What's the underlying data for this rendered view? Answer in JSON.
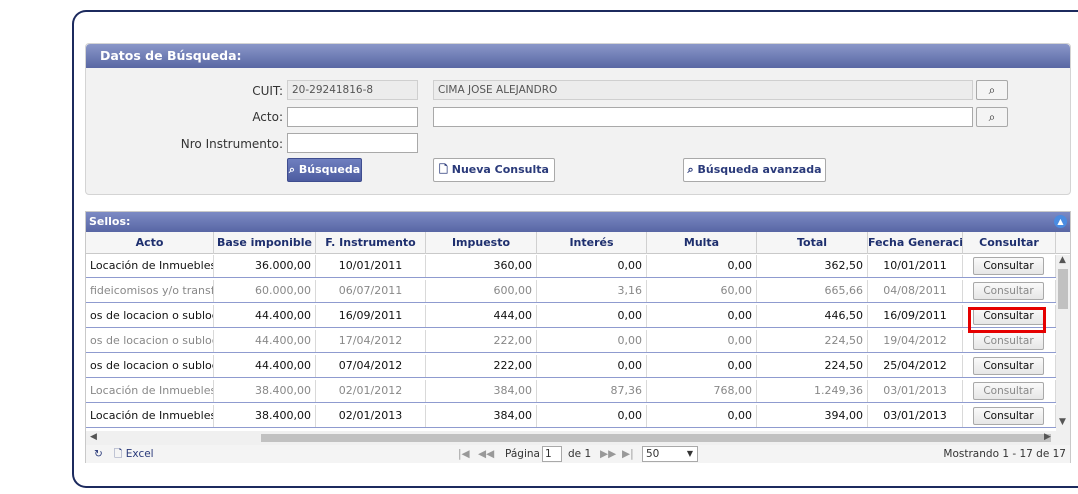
{
  "search_panel": {
    "title": "Datos de Búsqueda:",
    "cuit_label": "CUIT:",
    "cuit_value": "20-29241816-8",
    "name_value": "CIMA JOSE ALEJANDRO",
    "acto_label": "Acto:",
    "acto_value": "",
    "acto_desc_value": "",
    "nro_label": "Nro Instrumento:",
    "nro_value": "",
    "search_button": "Búsqueda",
    "new_query_button": "Nueva Consulta",
    "advanced_button": "Búsqueda avanzada"
  },
  "grid": {
    "caption": "Sellos:",
    "columns": [
      "Acto",
      "Base imponible",
      "F. Instrumento",
      "Impuesto",
      "Interés",
      "Multa",
      "Total",
      "Fecha Generación",
      "Consultar"
    ],
    "rows": [
      {
        "acto": "Locación de Inmuebles",
        "base": "36.000,00",
        "f_instrumento": "10/01/2011",
        "impuesto": "360,00",
        "interes": "0,00",
        "multa": "0,00",
        "total": "362,50",
        "fecha_gen": "10/01/2011",
        "btn": "Consultar",
        "style": "dark"
      },
      {
        "acto": "fideicomisos y/o transfer",
        "base": "60.000,00",
        "f_instrumento": "06/07/2011",
        "impuesto": "600,00",
        "interes": "3,16",
        "multa": "60,00",
        "total": "665,66",
        "fecha_gen": "04/08/2011",
        "btn": "Consultar",
        "style": "dim"
      },
      {
        "acto": "os de locacion o sublocacio",
        "base": "44.400,00",
        "f_instrumento": "16/09/2011",
        "impuesto": "444,00",
        "interes": "0,00",
        "multa": "0,00",
        "total": "446,50",
        "fecha_gen": "16/09/2011",
        "btn": "Consultar",
        "style": "dark"
      },
      {
        "acto": "os de locacion o sublocacio",
        "base": "44.400,00",
        "f_instrumento": "17/04/2012",
        "impuesto": "222,00",
        "interes": "0,00",
        "multa": "0,00",
        "total": "224,50",
        "fecha_gen": "19/04/2012",
        "btn": "Consultar",
        "style": "dim"
      },
      {
        "acto": "os de locacion o sublocacio",
        "base": "44.400,00",
        "f_instrumento": "07/04/2012",
        "impuesto": "222,00",
        "interes": "0,00",
        "multa": "0,00",
        "total": "224,50",
        "fecha_gen": "25/04/2012",
        "btn": "Consultar",
        "style": "dark"
      },
      {
        "acto": "Locación de Inmuebles",
        "base": "38.400,00",
        "f_instrumento": "02/01/2012",
        "impuesto": "384,00",
        "interes": "87,36",
        "multa": "768,00",
        "total": "1.249,36",
        "fecha_gen": "03/01/2013",
        "btn": "Consultar",
        "style": "dim"
      },
      {
        "acto": "Locación de Inmuebles",
        "base": "38.400,00",
        "f_instrumento": "02/01/2013",
        "impuesto": "384,00",
        "interes": "0,00",
        "multa": "0,00",
        "total": "394,00",
        "fecha_gen": "03/01/2013",
        "btn": "Consultar",
        "style": "dark"
      }
    ]
  },
  "pager": {
    "excel_label": "Excel",
    "page_label": "Página",
    "page_value": "1",
    "of_label": "de 1",
    "page_size": "50",
    "showing": "Mostrando 1 - 17 de 17"
  },
  "colors": {
    "header_blue": "#5967a3",
    "highlight_red": "#e50000"
  }
}
